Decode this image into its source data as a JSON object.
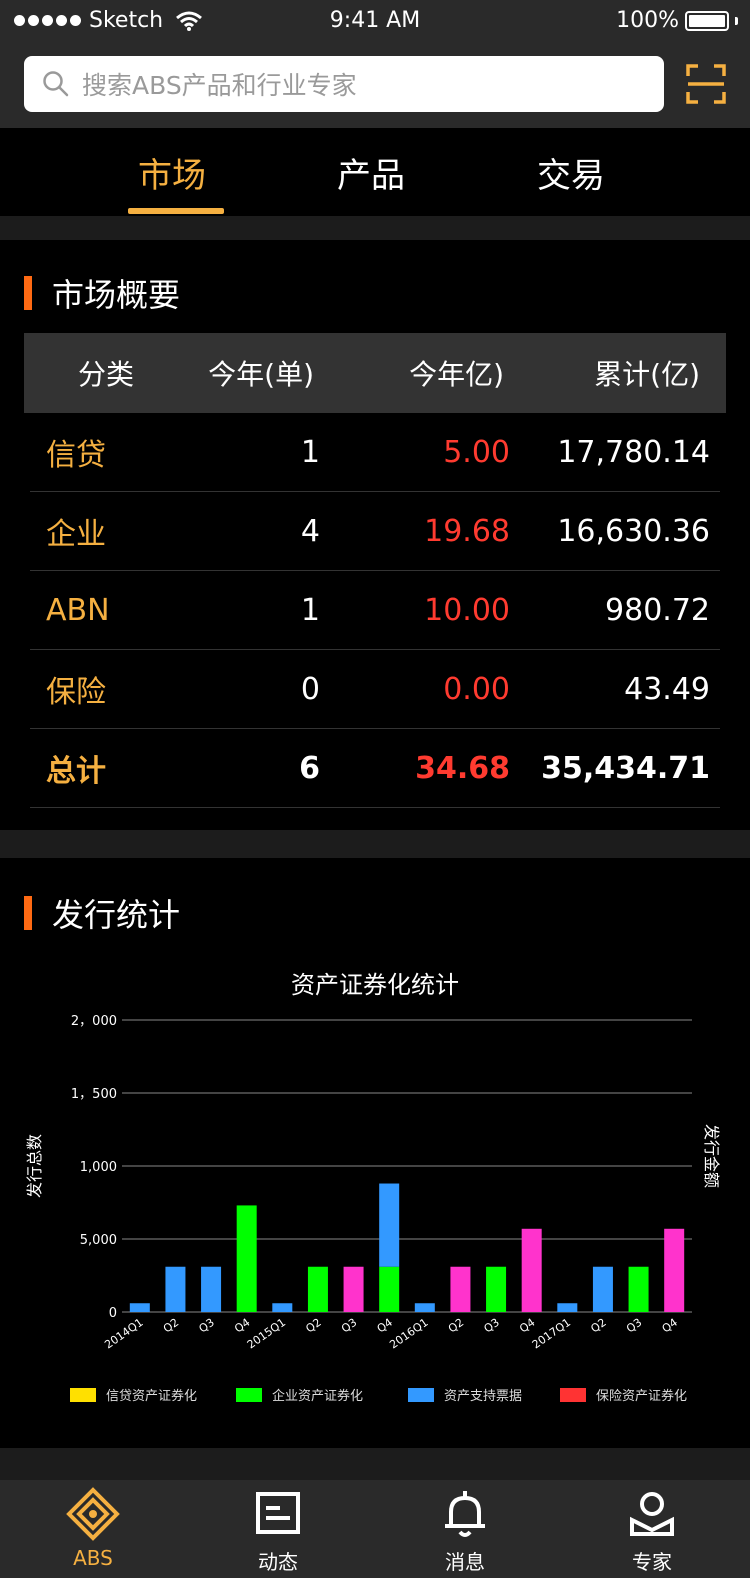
{
  "status_bar": {
    "carrier": "Sketch",
    "time": "9:41 AM",
    "battery": "100%"
  },
  "search": {
    "placeholder": "搜索ABS产品和行业专家"
  },
  "tabs": [
    {
      "label": "市场"
    },
    {
      "label": "产品"
    },
    {
      "label": "交易"
    }
  ],
  "market_summary": {
    "title": "市场概要",
    "headers": [
      "分类",
      "今年(单)",
      "今年亿)",
      "累计(亿)"
    ],
    "rows": [
      {
        "category": "信贷",
        "count": "1",
        "amount": "5.00",
        "total": "17,780.14"
      },
      {
        "category": "企业",
        "count": "4",
        "amount": "19.68",
        "total": "16,630.36"
      },
      {
        "category": "ABN",
        "count": "1",
        "amount": "10.00",
        "total": "980.72"
      },
      {
        "category": "保险",
        "count": "0",
        "amount": "0.00",
        "total": "43.49"
      },
      {
        "category": "总计",
        "count": "6",
        "amount": "34.68",
        "total": "35,434.71"
      }
    ]
  },
  "issuance": {
    "title": "发行统计"
  },
  "chart_data": {
    "type": "bar",
    "title": "资产证券化统计",
    "ylabel": "发行总数",
    "y2label": "发行金额",
    "y_ticks": [
      "0",
      "5,000",
      "1,000",
      "1，500",
      "2，000"
    ],
    "categories": [
      "2014Q1",
      "Q2",
      "Q3",
      "Q4",
      "2015Q1",
      "Q2",
      "Q3",
      "Q4",
      "2016Q1",
      "Q2",
      "Q3",
      "Q4",
      "2017Q1",
      "Q2",
      "Q3",
      "Q4"
    ],
    "ylim": [
      0,
      2000
    ],
    "grid": true,
    "legend_position": "bottom",
    "series": [
      {
        "name": "信贷资产证券化",
        "color": "#ffe000",
        "values": [
          0,
          0,
          0,
          0,
          0,
          0,
          0,
          0,
          0,
          0,
          0,
          0,
          0,
          0,
          0,
          0
        ]
      },
      {
        "name": "企业资产证券化",
        "color": "#00ff00",
        "values": [
          0,
          0,
          0,
          730,
          0,
          310,
          0,
          310,
          0,
          0,
          310,
          0,
          0,
          0,
          310,
          0
        ]
      },
      {
        "name": "资产支持票据",
        "color": "#3399ff",
        "values": [
          60,
          310,
          310,
          0,
          60,
          0,
          0,
          570,
          60,
          0,
          0,
          0,
          60,
          310,
          0,
          0
        ]
      },
      {
        "name": "保险资产证券化",
        "color": "#ff3333",
        "values": [
          0,
          0,
          0,
          0,
          0,
          0,
          0,
          0,
          0,
          0,
          0,
          0,
          0,
          0,
          0,
          0
        ]
      },
      {
        "name": "",
        "color": "#ff33cc",
        "values": [
          0,
          0,
          0,
          0,
          0,
          0,
          310,
          0,
          0,
          310,
          0,
          570,
          0,
          0,
          0,
          570
        ]
      }
    ]
  },
  "bottom_nav": [
    {
      "label": "ABS",
      "icon": "abs-icon"
    },
    {
      "label": "动态",
      "icon": "news-icon"
    },
    {
      "label": "消息",
      "icon": "bell-icon"
    },
    {
      "label": "专家",
      "icon": "expert-icon"
    }
  ],
  "colors": {
    "accent": "#f5b041",
    "red": "#ff3b30",
    "section_bar": "#ff6a13"
  }
}
